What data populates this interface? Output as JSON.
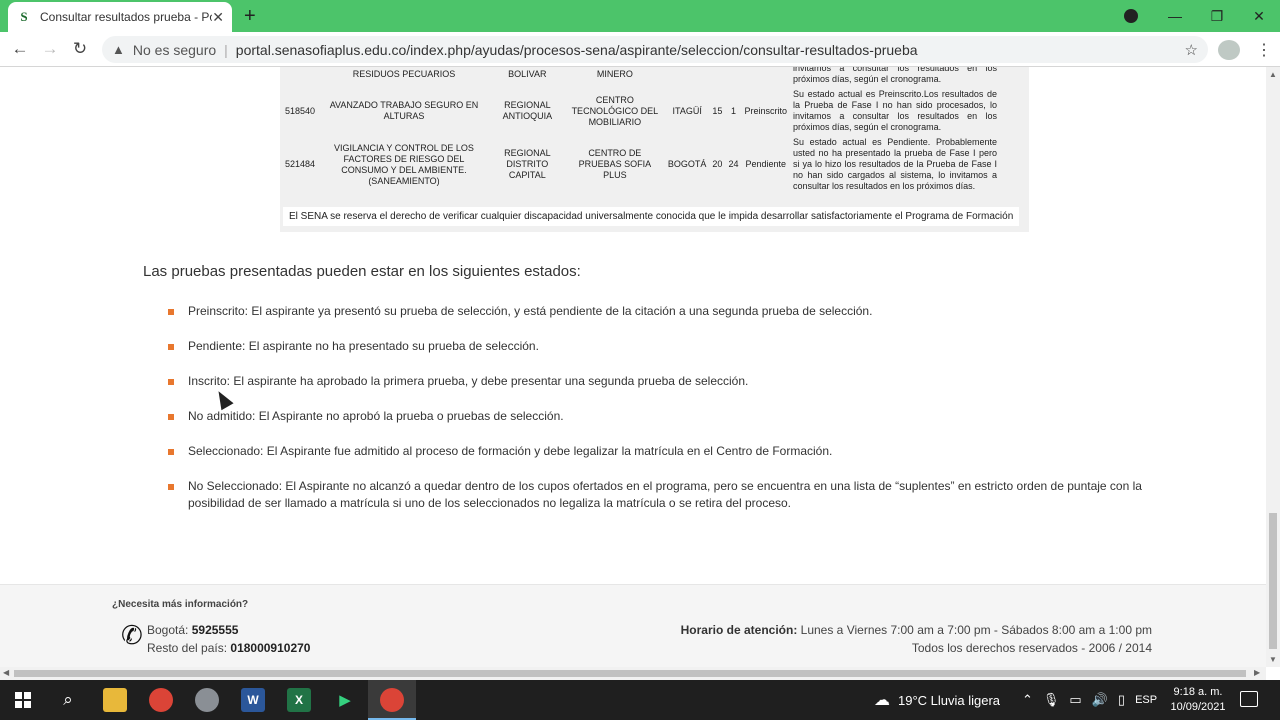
{
  "browser": {
    "tab_title": "Consultar resultados prueba - Po",
    "tab_favicon": "S",
    "not_secure": "No es seguro",
    "url": "portal.senasofiaplus.edu.co/index.php/ayudas/procesos-sena/aspirante/seleccion/consultar-resultados-prueba"
  },
  "table": {
    "rows": [
      {
        "code": "",
        "program": "RESIDUOS PECUARIOS",
        "regional": "BOLIVAR",
        "centro": "MINERO",
        "ciudad": "",
        "n1": "",
        "n2": "",
        "estado": "",
        "detalle": "invitamos a consultar los resultados en los próximos días, según el cronograma."
      },
      {
        "code": "518540",
        "program": "AVANZADO TRABAJO SEGURO EN ALTURAS",
        "regional": "REGIONAL ANTIOQUIA",
        "centro": "CENTRO TECNOLÓGICO DEL MOBILIARIO",
        "ciudad": "ITAGÜÍ",
        "n1": "15",
        "n2": "1",
        "estado": "Preinscrito",
        "detalle": "Su estado actual es Preinscrito.Los resultados de la Prueba de Fase I no han sido procesados, lo invitamos a consultar los resultados en los próximos días, según el cronograma."
      },
      {
        "code": "521484",
        "program": "VIGILANCIA Y CONTROL DE LOS FACTORES DE RIESGO DEL CONSUMO Y DEL AMBIENTE. (SANEAMIENTO)",
        "regional": "REGIONAL DISTRITO CAPITAL",
        "centro": "CENTRO DE PRUEBAS SOFIA PLUS",
        "ciudad": "BOGOTÁ",
        "n1": "20",
        "n2": "24",
        "estado": "Pendiente",
        "detalle": "Su estado actual es Pendiente. Probablemente usted no ha presentado la prueba de Fase I pero si ya lo hizo los resultados de la Prueba de Fase I no han sido cargados al sistema, lo invitamos a consultar los resultados en los próximos días."
      }
    ],
    "disclaimer": "El SENA se reserva el derecho de verificar cualquier discapacidad universalmente conocida que le impida desarrollar satisfactoriamente el Programa de Formación"
  },
  "intro": "Las pruebas presentadas pueden estar en los siguientes estados:",
  "states": [
    "Preinscrito: El aspirante ya presentó su prueba de selección, y está pendiente de la citación a una segunda prueba de selección.",
    "Pendiente: El aspirante no ha presentado su prueba de selección.",
    "Inscrito: El aspirante ha aprobado la primera prueba, y debe presentar una segunda prueba de selección.",
    "No admitido: El Aspirante no aprobó la prueba o pruebas de selección.",
    "Seleccionado: El Aspirante fue admitido al proceso de formación y debe legalizar la matrícula en el Centro de Formación.",
    "No Seleccionado: El Aspirante no alcanzó a quedar dentro de los cupos ofertados en el programa, pero se encuentra en una lista de “suplentes” en estricto orden de puntaje con la posibilidad de ser llamado a matrícula si uno de los seleccionados no legaliza la matrícula o se retira del proceso."
  ],
  "footer": {
    "need_info": "¿Necesita más información?",
    "bogota_label": "Bogotá:",
    "bogota_phone": "5925555",
    "rest_label": "Resto del país:",
    "rest_phone": "018000910270",
    "hours_label": "Horario de atención:",
    "hours_value": "Lunes a Viernes 7:00 am a 7:00 pm - Sábados 8:00 am a 1:00 pm",
    "rights": "Todos los derechos reservados - 2006 / 2014"
  },
  "taskbar": {
    "weather": "19°C  Lluvia ligera",
    "lang": "ESP",
    "time": "9:18 a. m.",
    "date": "10/09/2021"
  }
}
